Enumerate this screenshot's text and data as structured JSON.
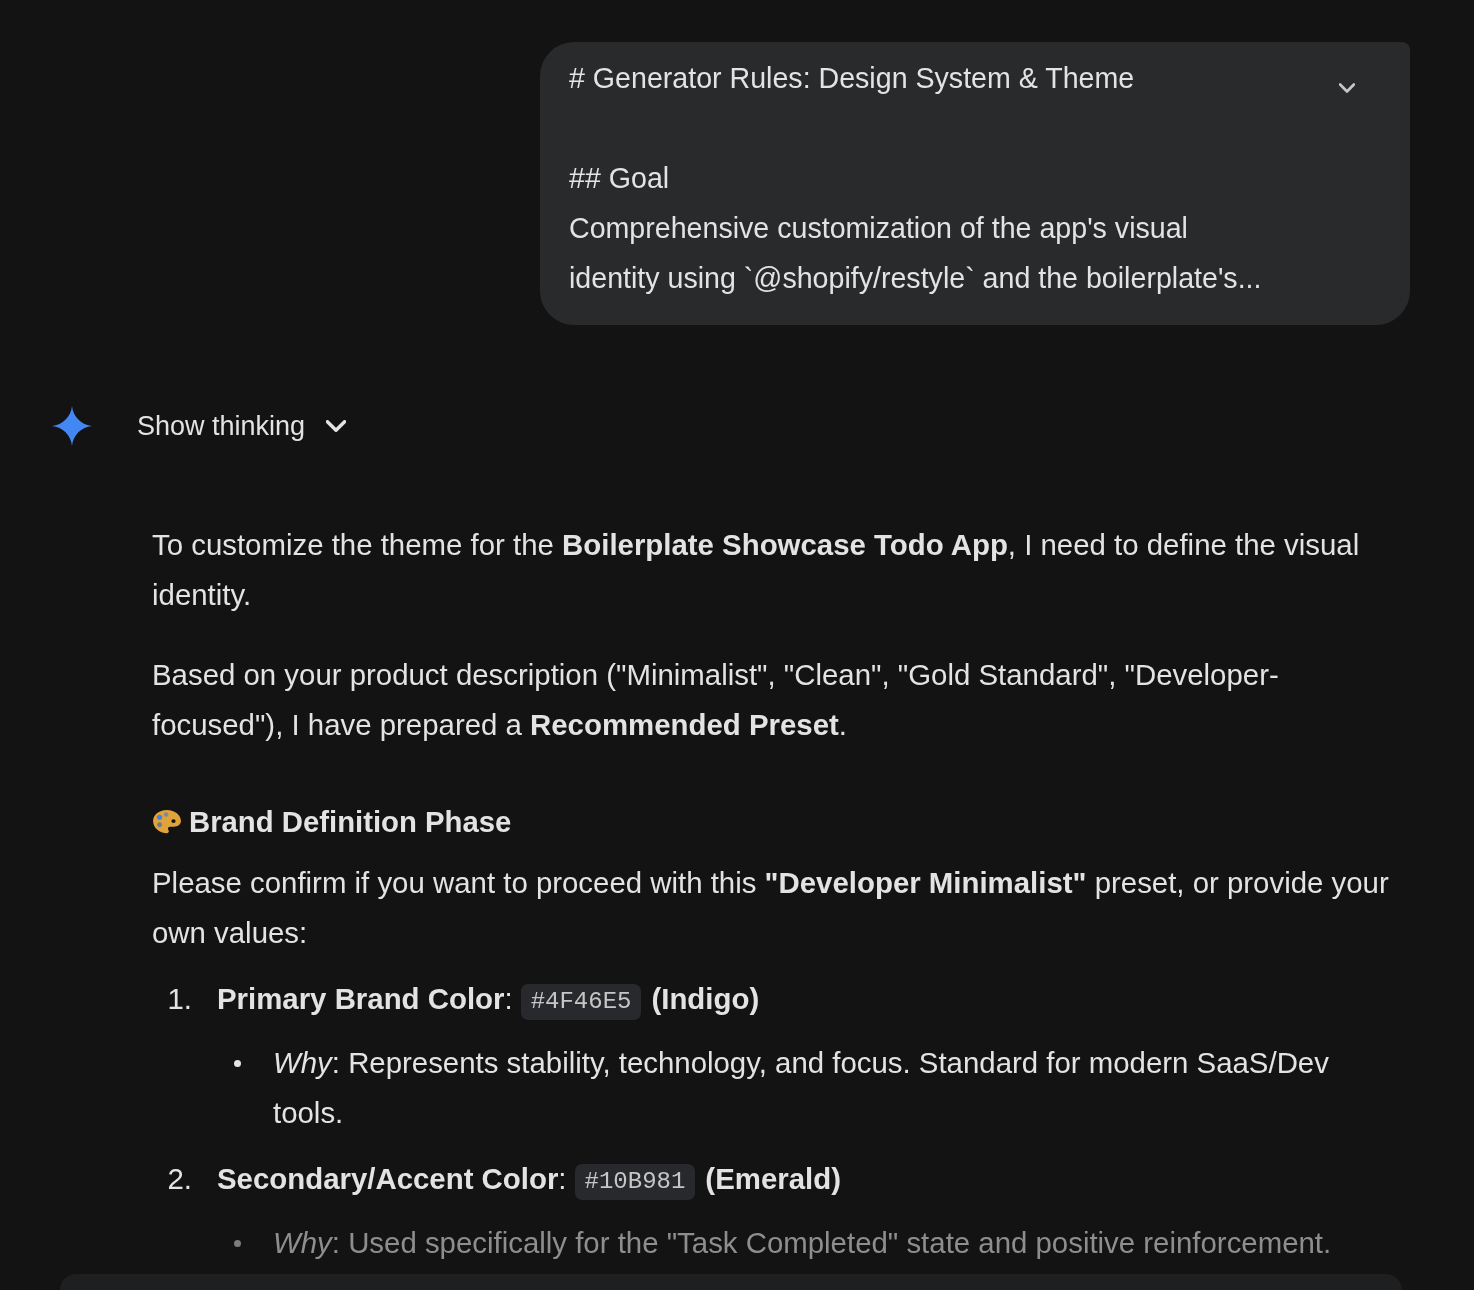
{
  "user_message": {
    "title": "# Generator Rules: Design System & Theme",
    "lines": [
      "## Goal",
      "Comprehensive customization of the app's visual",
      "identity using `@shopify/restyle` and the boilerplate's..."
    ],
    "expanded": false
  },
  "thinking": {
    "label": "Show thinking",
    "expanded": false
  },
  "response": {
    "paragraphs": [
      "To customize the theme for the **Boilerplate Showcase Todo App**, I need to define the visual identity.",
      "Based on your product description (\"Minimalist\", \"Clean\", \"Gold Standard\", \"Developer-focused\"), I have prepared a **Recommended Preset**."
    ],
    "heading": "Brand Definition Phase",
    "intro": "Please confirm if you want to proceed with this **\"Developer Minimalist\"** preset, or provide your own values:",
    "items": [
      {
        "number": "1.",
        "label": "**Primary Brand Color**:",
        "code": "#4F46E5",
        "note": "(Indigo)",
        "bullets": [
          {
            "text": "*Why*: Represents stability, technology, and focus. Standard for modern SaaS/Dev tools.",
            "faded": false
          }
        ]
      },
      {
        "number": "2.",
        "label": "**Secondary/Accent Color**:",
        "code": "#10B981",
        "note": "(Emerald)",
        "bullets": [
          {
            "text": "*Why*: Used specifically for the \"Task Completed\" state and positive reinforcement.",
            "faded": true
          }
        ]
      }
    ]
  }
}
